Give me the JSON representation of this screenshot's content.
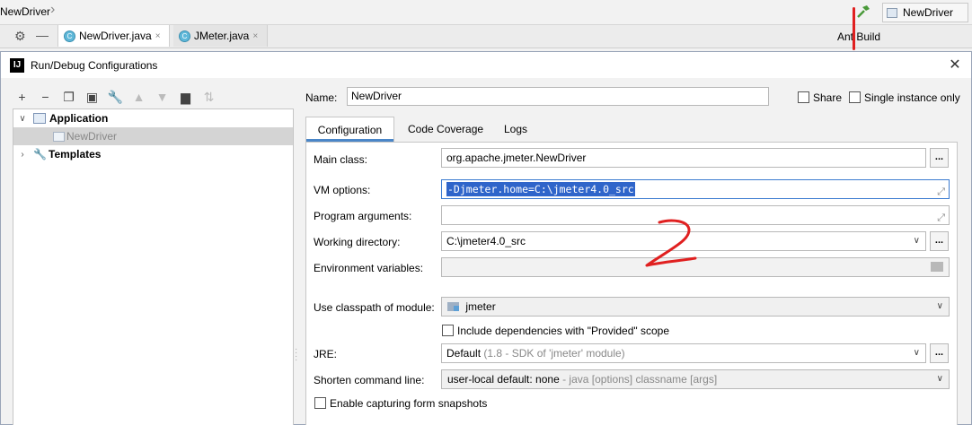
{
  "ide": {
    "breadcrumb": "NewDriver",
    "run_config": "NewDriver",
    "file_tabs": [
      {
        "label": "NewDriver.java",
        "close": "×"
      },
      {
        "label": "JMeter.java",
        "close": "×"
      }
    ],
    "ant_build": "Ant Build"
  },
  "dialog": {
    "title": "Run/Debug Configurations",
    "app_icon": "IJ",
    "close": "✕"
  },
  "tree": {
    "application": "Application",
    "newdriver": "NewDriver",
    "templates": "Templates"
  },
  "form": {
    "name_label": "Name:",
    "name_value": "NewDriver",
    "share_label": "Share",
    "single_instance_label": "Single instance only",
    "tabs": [
      "Configuration",
      "Code Coverage",
      "Logs"
    ],
    "main_class_label": "Main class:",
    "main_class_value": "org.apache.jmeter.NewDriver",
    "vm_options_label": "VM options:",
    "vm_options_value": "-Djmeter.home=C:\\jmeter4.0_src",
    "program_args_label": "Program arguments:",
    "program_args_value": "",
    "working_dir_label": "Working directory:",
    "working_dir_value": "C:\\jmeter4.0_src",
    "env_vars_label": "Environment variables:",
    "env_vars_value": "",
    "classpath_label": "Use classpath of module:",
    "classpath_value": "jmeter",
    "include_deps_label": "Include dependencies with \"Provided\" scope",
    "jre_label": "JRE:",
    "jre_value": "Default",
    "jre_hint": "(1.8 - SDK of 'jmeter' module)",
    "shorten_label": "Shorten command line:",
    "shorten_value": "user-local default: none",
    "shorten_hint": "- java [options] classname [args]",
    "capture_label": "Enable capturing form snapshots",
    "ellipsis": "..."
  },
  "annotation_color": "#e02020"
}
